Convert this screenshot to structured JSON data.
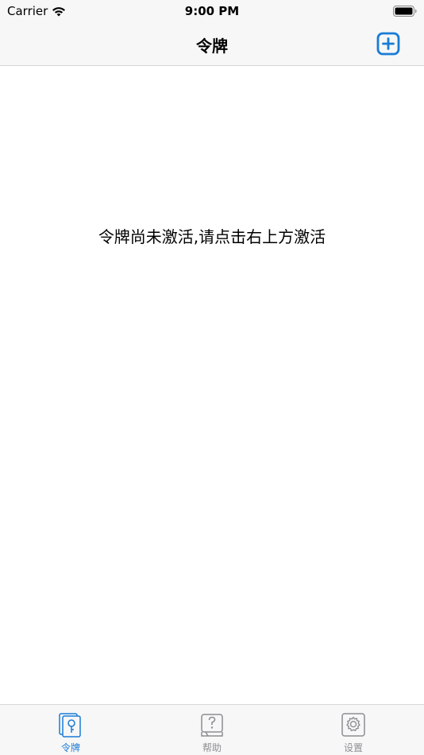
{
  "status_bar": {
    "carrier": "Carrier",
    "time": "9:00 PM"
  },
  "nav": {
    "title": "令牌",
    "add_icon": "plus-square-icon"
  },
  "content": {
    "empty_message": "令牌尚未激活,请点击右上方激活"
  },
  "tabs": [
    {
      "label": "令牌",
      "icon": "token-icon",
      "active": true
    },
    {
      "label": "帮助",
      "icon": "help-icon",
      "active": false
    },
    {
      "label": "设置",
      "icon": "settings-icon",
      "active": false
    }
  ],
  "colors": {
    "accent": "#1a7bd6",
    "inactive": "#8e8e93",
    "bar_background": "#f7f7f7"
  }
}
